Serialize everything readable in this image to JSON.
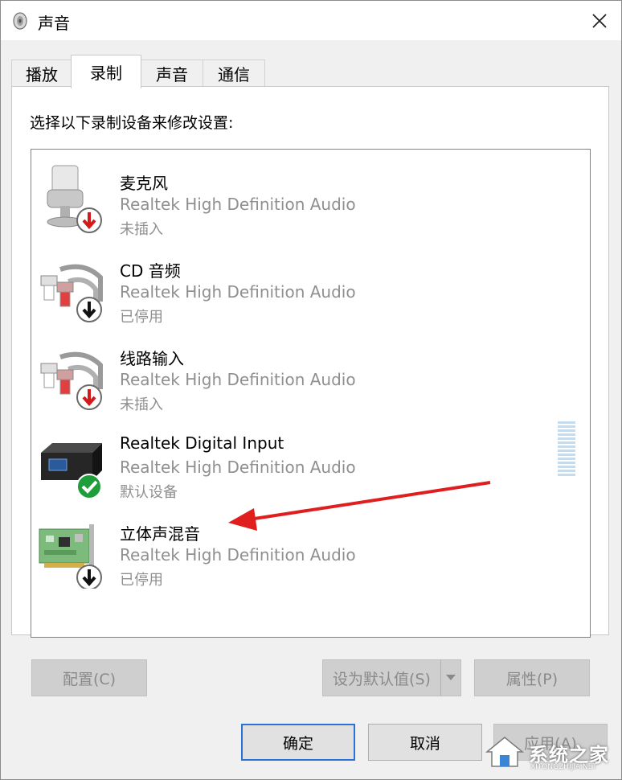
{
  "window": {
    "title": "声音"
  },
  "tabs": [
    {
      "label": "播放",
      "active": false
    },
    {
      "label": "录制",
      "active": true
    },
    {
      "label": "声音",
      "active": false
    },
    {
      "label": "通信",
      "active": false
    }
  ],
  "instruction": "选择以下录制设备来修改设置:",
  "devices": [
    {
      "name": "麦克风",
      "driver": "Realtek High Definition Audio",
      "status": "未插入",
      "icon": "microphone-icon",
      "badge": "red-down-arrow"
    },
    {
      "name": "CD 音频",
      "driver": "Realtek High Definition Audio",
      "status": "已停用",
      "icon": "rca-cable-icon",
      "badge": "black-down-arrow"
    },
    {
      "name": "线路输入",
      "driver": "Realtek High Definition Audio",
      "status": "未插入",
      "icon": "rca-cable-icon",
      "badge": "red-down-arrow"
    },
    {
      "name": "Realtek Digital Input",
      "driver": "Realtek High Definition Audio",
      "status": "默认设备",
      "icon": "digital-input-box-icon",
      "badge": "green-check"
    },
    {
      "name": "立体声混音",
      "driver": "Realtek High Definition Audio",
      "status": "已停用",
      "icon": "sound-card-icon",
      "badge": "black-down-arrow"
    }
  ],
  "buttons": {
    "configure": "配置(C)",
    "set_default": "设为默认值(S)",
    "properties": "属性(P)",
    "ok": "确定",
    "cancel": "取消",
    "apply": "应用(A)"
  },
  "watermark": {
    "text": "系统之家",
    "sub": "XITONGZHIJIA.NET"
  },
  "colors": {
    "accent_border": "#2a72d6",
    "annotation_arrow": "#e01e1e",
    "check_green": "#1e9e3a",
    "disabled_text": "#8a8a8a"
  }
}
